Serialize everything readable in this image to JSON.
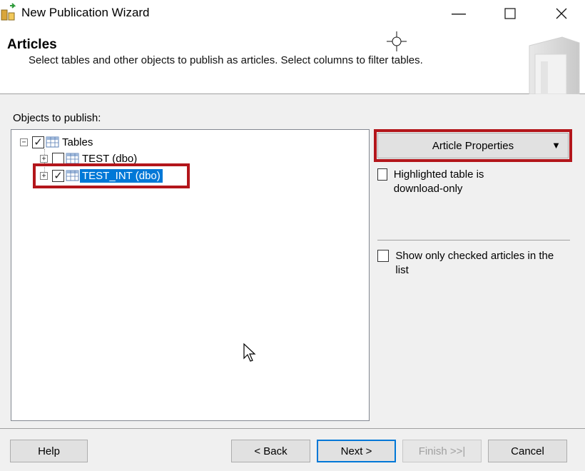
{
  "window": {
    "title": "New Publication Wizard",
    "minimize_glyph": "—",
    "maximize_glyph": "☐",
    "close_glyph": "✕"
  },
  "header": {
    "title": "Articles",
    "subtitle": "Select tables and other objects to publish as articles. Select columns to filter tables."
  },
  "tree": {
    "label": "Objects to publish:",
    "root": {
      "label": "Tables",
      "checked": true,
      "expander": "−"
    },
    "items": [
      {
        "label": "TEST (dbo)",
        "checked": false,
        "expander": "+",
        "selected": false
      },
      {
        "label": "TEST_INT (dbo)",
        "checked": true,
        "expander": "+",
        "selected": true
      }
    ]
  },
  "right_panel": {
    "article_properties_label": "Article Properties",
    "dropdown_arrow": "▼",
    "options": [
      {
        "label": "Highlighted table is download-only",
        "checked": false
      },
      {
        "label": "Show only checked articles in the list",
        "checked": false
      }
    ]
  },
  "footer": {
    "help": "Help",
    "back": "< Back",
    "next": "Next >",
    "finish": "Finish >>|",
    "cancel": "Cancel"
  },
  "colors": {
    "highlight_border": "#b3161b",
    "selection": "#0078d7"
  },
  "icons": {
    "app": "publication-wizard-icon",
    "table": "table-icon",
    "cursor": "mouse-pointer-icon",
    "crosshair": "crosshair-icon"
  }
}
